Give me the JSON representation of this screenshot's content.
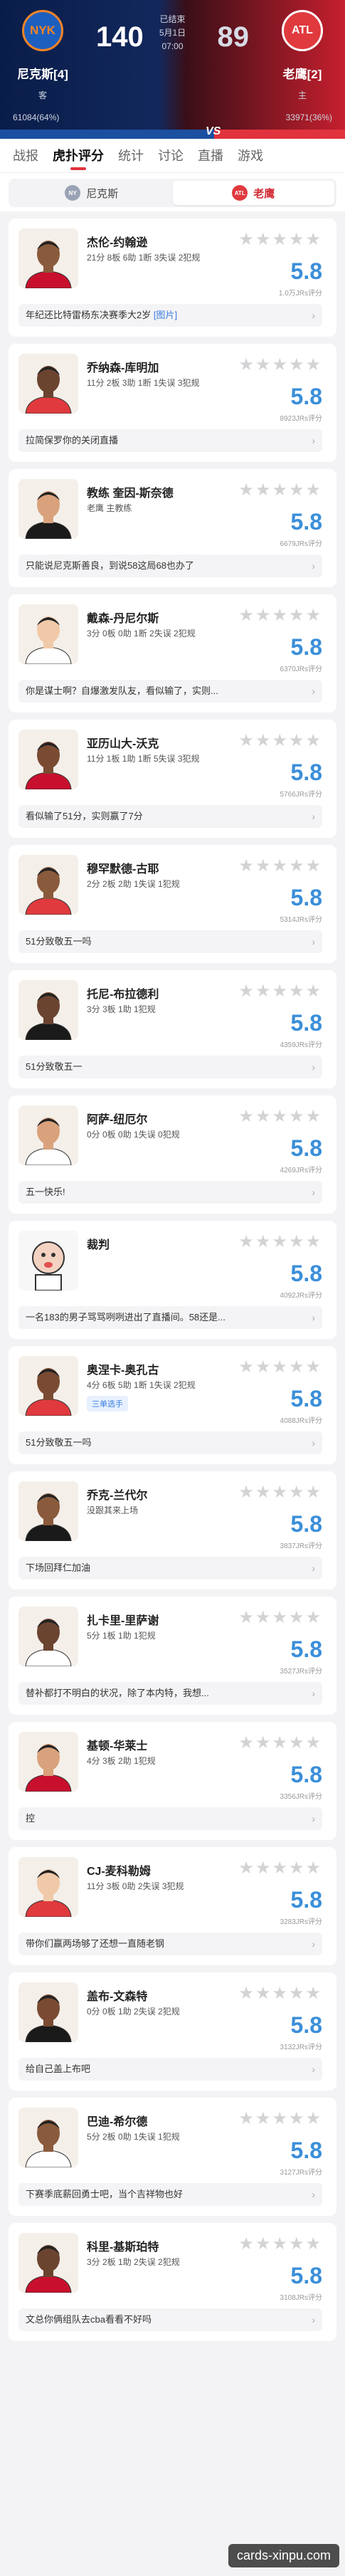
{
  "header": {
    "home_team": {
      "logo": "NYK",
      "name": "尼克斯[4]",
      "tag": "客",
      "score": "140",
      "support": "61084(64%)"
    },
    "away_team": {
      "logo": "ATL",
      "name": "老鹰[2]",
      "tag": "主",
      "score": "89",
      "support": "33971(36%)"
    },
    "status": "已结束",
    "date": "5月1日",
    "time": "07:00",
    "vs_label": "VS",
    "support_share_home": 0.64
  },
  "tabs": [
    "战报",
    "虎扑评分",
    "统计",
    "讨论",
    "直播",
    "游戏"
  ],
  "active_tab": "虎扑评分",
  "toggle": {
    "home": "尼克斯",
    "away": "老鹰"
  },
  "players": [
    {
      "name": "杰伦-约翰逊",
      "stats": "21分 8板 6助 1断 3失误 2犯规",
      "rating": "5.8",
      "count": "1.0万JRs评分",
      "comment": "年纪还比特雷杨东决赛季大2岁",
      "comment_extra": "[图片]"
    },
    {
      "name": "乔纳森-库明加",
      "stats": "11分 2板 3助 1断 1失误 3犯规",
      "rating": "5.8",
      "count": "8923JRs评分",
      "comment": "拉简保罗你的关闭直播"
    },
    {
      "name": "教练 奎因-斯奈德",
      "stats": "老鹰 主教练",
      "rating": "5.8",
      "count": "6679JRs评分",
      "comment": "只能说尼克斯善良，到说58这局68也办了"
    },
    {
      "name": "戴森-丹尼尔斯",
      "stats": "3分 0板 0助 1断 2失误 2犯规",
      "rating": "5.8",
      "count": "6370JRs评分",
      "comment": "你是谋士啊？自爆激发队友，看似输了，实则..."
    },
    {
      "name": "亚历山大-沃克",
      "stats": "11分 1板 1助 1断 5失误 3犯规",
      "rating": "5.8",
      "count": "5766JRs评分",
      "comment": "看似输了51分，实则赢了7分"
    },
    {
      "name": "穆罕默德-古耶",
      "stats": "2分 2板 2助 1失误 1犯规",
      "rating": "5.8",
      "count": "5314JRs评分",
      "comment": "51分致敬五一吗"
    },
    {
      "name": "托尼-布拉德利",
      "stats": "3分 3板 1助 1犯规",
      "rating": "5.8",
      "count": "4359JRs评分",
      "comment": "51分致敬五一"
    },
    {
      "name": "阿萨-纽厄尔",
      "stats": "0分 0板 0助 1失误 0犯规",
      "rating": "5.8",
      "count": "4269JRs评分",
      "comment": "五一快乐!"
    },
    {
      "name": "裁判",
      "stats": "",
      "rating": "5.8",
      "count": "4092JRs评分",
      "comment": "一名183的男子骂骂咧咧进出了直播间。58还是..."
    },
    {
      "name": "奥涅卡-奥孔古",
      "stats": "4分 6板 5助 1断 1失误 2犯规",
      "rating": "5.8",
      "count": "4088JRs评分",
      "badge": "三单选手",
      "comment": "51分致敬五一吗"
    },
    {
      "name": "乔克-兰代尔",
      "stats": "没跟其来上场",
      "rating": "5.8",
      "count": "3837JRs评分",
      "comment": "下场回拜仁加油"
    },
    {
      "name": "扎卡里-里萨谢",
      "stats": "5分 1板 1助 1犯规",
      "rating": "5.8",
      "count": "3527JRs评分",
      "comment": "替补都打不明白的状况，除了本内特，我想..."
    },
    {
      "name": "基顿-华莱士",
      "stats": "4分 3板 2助 1犯规",
      "rating": "5.8",
      "count": "3356JRs评分",
      "comment": "控"
    },
    {
      "name": "CJ-麦科勒姆",
      "stats": "11分 3板 0助 2失误 3犯规",
      "rating": "5.8",
      "count": "3283JRs评分",
      "comment": "带你们赢两场够了还想一直随老钢"
    },
    {
      "name": "盖布-文森特",
      "stats": "0分 0板 1助 2失误 2犯规",
      "rating": "5.8",
      "count": "3132JRs评分",
      "comment": "给自己盖上布吧"
    },
    {
      "name": "巴迪-希尔德",
      "stats": "5分 2板 0助 1失误 1犯规",
      "rating": "5.8",
      "count": "3127JRs评分",
      "comment": "下赛季底薪回勇士吧，当个吉祥物也好"
    },
    {
      "name": "科里-基斯珀特",
      "stats": "3分 2板 1助 2失误 2犯规",
      "rating": "5.8",
      "count": "3108JRs评分",
      "comment": "文总你俩组队去cba看看不好吗"
    }
  ],
  "stars_empty": "★★★★★",
  "watermark": "cards-xinpu.com",
  "colors": {
    "accent": "#e0333d",
    "rating_blue": "#3b8fd9",
    "knicks_blue": "#1b4fa0"
  }
}
